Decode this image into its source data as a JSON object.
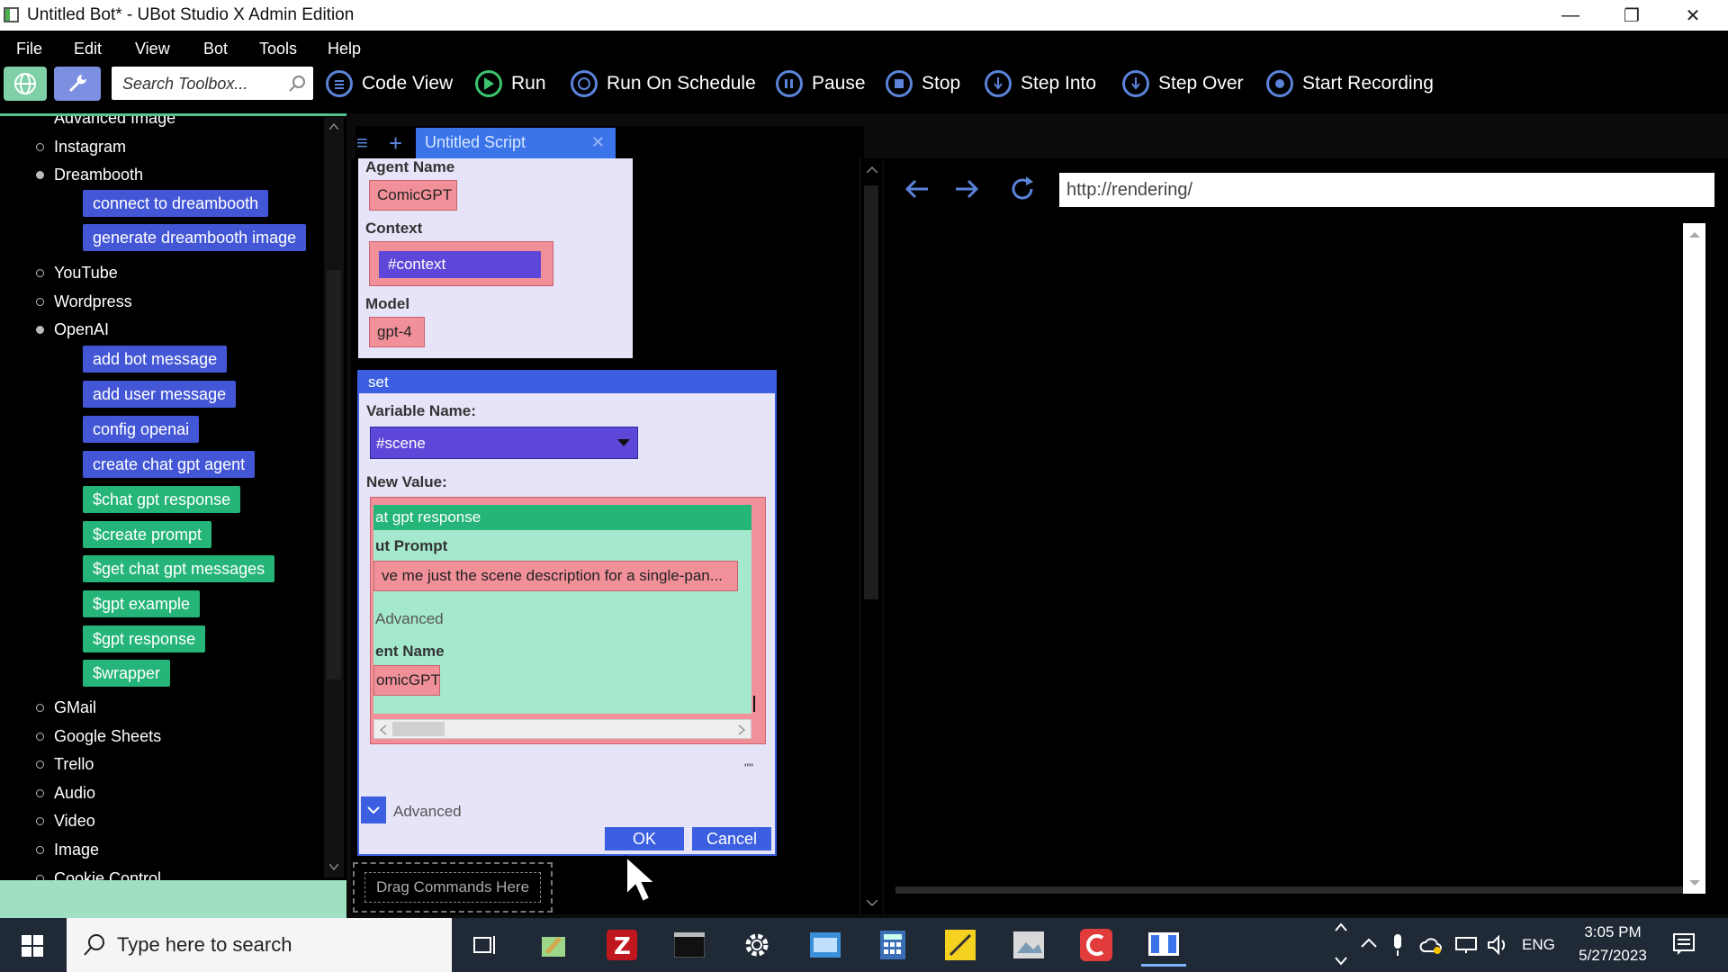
{
  "window": {
    "title": "Untitled Bot* - UBot Studio X Admin Edition",
    "minimize": "—",
    "restore": "❐",
    "close": "✕"
  },
  "menu": [
    "File",
    "Edit",
    "View",
    "Bot",
    "Tools",
    "Help"
  ],
  "toolbar": {
    "search_placeholder": "Search Toolbox...",
    "buttons": [
      "Code View",
      "Run",
      "Run On Schedule",
      "Pause",
      "Stop",
      "Step Into",
      "Step Over",
      "Start Recording"
    ]
  },
  "toolbox": {
    "clipped_top": "Advanced Image",
    "items": {
      "instagram": "Instagram",
      "dreambooth": "Dreambooth",
      "dreambooth_cmds": [
        "connect to dreambooth",
        "generate dreambooth image"
      ],
      "youtube": "YouTube",
      "wordpress": "Wordpress",
      "openai": "OpenAI",
      "openai_cmds": [
        "add bot message",
        "add user message",
        "config openai",
        "create chat gpt agent"
      ],
      "openai_funcs": [
        "$chat gpt response",
        "$create prompt",
        "$get chat gpt messages",
        "$gpt example",
        "$gpt response",
        "$wrapper"
      ],
      "rest": [
        "GMail",
        "Google Sheets",
        "Trello",
        "Audio",
        "Video",
        "Image",
        "Cookie Control"
      ]
    }
  },
  "script_tab": {
    "label": "Untitled Script",
    "close": "✕",
    "menu_icon": "≡",
    "add_icon": "+"
  },
  "agent_panel": {
    "agent_name_label": "Agent Name",
    "agent_name_value": "ComicGPT",
    "context_label": "Context",
    "context_value": "#context",
    "model_label": "Model",
    "model_value": "gpt-4"
  },
  "set_dialog": {
    "title": "set",
    "variable_name_label": "Variable Name:",
    "variable_name_value": "#scene",
    "new_value_label": "New Value:",
    "nested": {
      "header": "at gpt response",
      "prompt_label": "ut Prompt",
      "prompt_value": "ve me just the scene description for a single-pan...",
      "advanced": "Advanced",
      "agent_label": "ent Name",
      "agent_value": "omicGPT"
    },
    "quote_mark": "\"\"",
    "advanced_label": "Advanced",
    "ok": "OK",
    "cancel": "Cancel"
  },
  "drag_placeholder": "Drag Commands Here",
  "browser": {
    "url": "http://rendering/"
  },
  "taskbar": {
    "search_placeholder": "Type here to search",
    "language": "ENG",
    "time": "3:05 PM",
    "date": "5/27/2023"
  },
  "colors": {
    "command_blue": "#4357d6",
    "function_green": "#25b578",
    "param_red": "#f19099",
    "accent_blue": "#3b5fe0",
    "panel_lavender": "#e6e4f8",
    "nested_green": "#a4e8cd"
  }
}
